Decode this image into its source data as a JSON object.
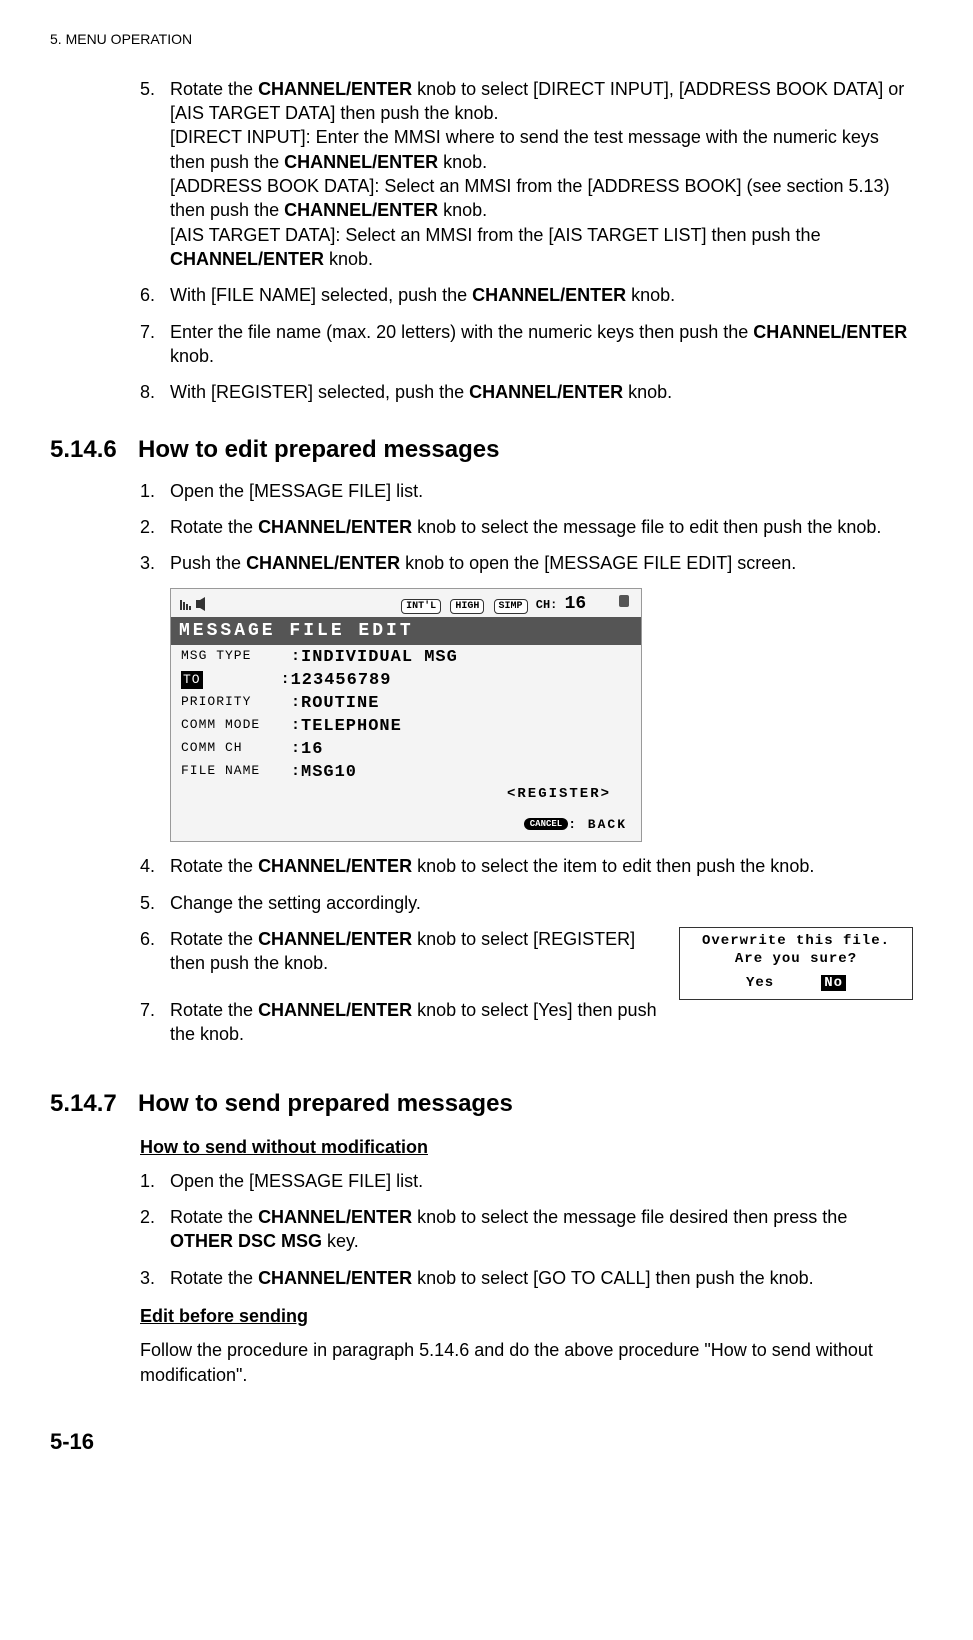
{
  "header": "5.  MENU OPERATION",
  "steps_a": {
    "s5": {
      "num": "5.",
      "p1a": "Rotate the ",
      "p1b": "CHANNEL/ENTER",
      "p1c": " knob to select [DIRECT INPUT], [ADDRESS BOOK DATA] or [AIS TARGET DATA] then push the knob.",
      "p2a": "[DIRECT INPUT]: Enter the MMSI where to send the test message with the numeric keys then push the ",
      "p2b": "CHANNEL/ENTER",
      "p2c": " knob.",
      "p3a": "[ADDRESS BOOK DATA]: Select an MMSI from the [ADDRESS BOOK] (see section 5.13) then push the ",
      "p3b": "CHANNEL/ENTER",
      "p3c": " knob.",
      "p4a": "[AIS TARGET DATA]: Select an MMSI from the [AIS TARGET LIST] then push the ",
      "p4b": "CHANNEL/ENTER",
      "p4c": " knob."
    },
    "s6": {
      "num": "6.",
      "a": "With [FILE NAME] selected, push the ",
      "b": "CHANNEL/ENTER",
      "c": " knob."
    },
    "s7": {
      "num": "7.",
      "a": "Enter the file name (max. 20 letters) with the numeric keys then push the ",
      "b": "CHANNEL/ENTER",
      "c": " knob."
    },
    "s8": {
      "num": "8.",
      "a": "With [REGISTER] selected, push the ",
      "b": "CHANNEL/ENTER",
      "c": " knob."
    }
  },
  "sec6": {
    "num": "5.14.6",
    "title": "How to edit prepared messages"
  },
  "steps_b": {
    "s1": {
      "num": "1.",
      "t": "Open the [MESSAGE FILE] list."
    },
    "s2": {
      "num": "2.",
      "a": "Rotate the ",
      "b": "CHANNEL/ENTER",
      "c": " knob to select the message file to edit then push the knob."
    },
    "s3": {
      "num": "3.",
      "a": "Push the ",
      "b": "CHANNEL/ENTER",
      "c": " knob to open the [MESSAGE FILE EDIT] screen."
    },
    "s4": {
      "num": "4.",
      "a": "Rotate the ",
      "b": "CHANNEL/ENTER",
      "c": " knob to select the item to edit then push the knob."
    },
    "s5": {
      "num": "5.",
      "t": "Change the setting accordingly."
    },
    "s6": {
      "num": "6.",
      "a": "Rotate the ",
      "b": "CHANNEL/ENTER",
      "c": " knob to select [REGISTER] then push the knob."
    },
    "s7": {
      "num": "7.",
      "a": "Rotate the ",
      "b": "CHANNEL/ENTER",
      "c": " knob to select [Yes] then push the knob."
    }
  },
  "screen": {
    "pills": {
      "intl": "INT'L",
      "high": "HIGH",
      "simp": "SIMP"
    },
    "ch_label": "CH:",
    "ch_value": "16",
    "title": "MESSAGE FILE EDIT",
    "rows": {
      "msg_type": {
        "lab": "MSG TYPE",
        "val": "INDIVIDUAL MSG"
      },
      "to": {
        "lab": "TO",
        "val": "123456789"
      },
      "priority": {
        "lab": "PRIORITY",
        "val": "ROUTINE"
      },
      "comm_mode": {
        "lab": "COMM MODE",
        "val": "TELEPHONE"
      },
      "comm_ch": {
        "lab": "COMM CH",
        "val": "16"
      },
      "file_name": {
        "lab": "FILE NAME",
        "val": "MSG10"
      }
    },
    "register": "<REGISTER>",
    "foot_cancel": "CANCEL",
    "foot_back": ": BACK"
  },
  "dialog": {
    "l1": "Overwrite this file.",
    "l2": "Are you sure?",
    "yes": "Yes",
    "no": "No"
  },
  "sec7": {
    "num": "5.14.7",
    "title": "How to send prepared messages"
  },
  "sub1": "How to send without modification",
  "steps_c": {
    "s1": {
      "num": "1.",
      "t": "Open the [MESSAGE FILE] list."
    },
    "s2": {
      "num": "2.",
      "a": "Rotate the ",
      "b": "CHANNEL/ENTER",
      "c": " knob to select the message file desired then press the ",
      "d": "OTHER DSC MSG",
      "e": " key."
    },
    "s3": {
      "num": "3.",
      "a": "Rotate the ",
      "b": "CHANNEL/ENTER",
      "c": " knob to select [GO TO CALL] then push the knob."
    }
  },
  "sub2": "Edit before sending",
  "para2": "Follow the procedure in paragraph 5.14.6 and do the above procedure \"How to send without modification\".",
  "pagefoot": "5-16"
}
